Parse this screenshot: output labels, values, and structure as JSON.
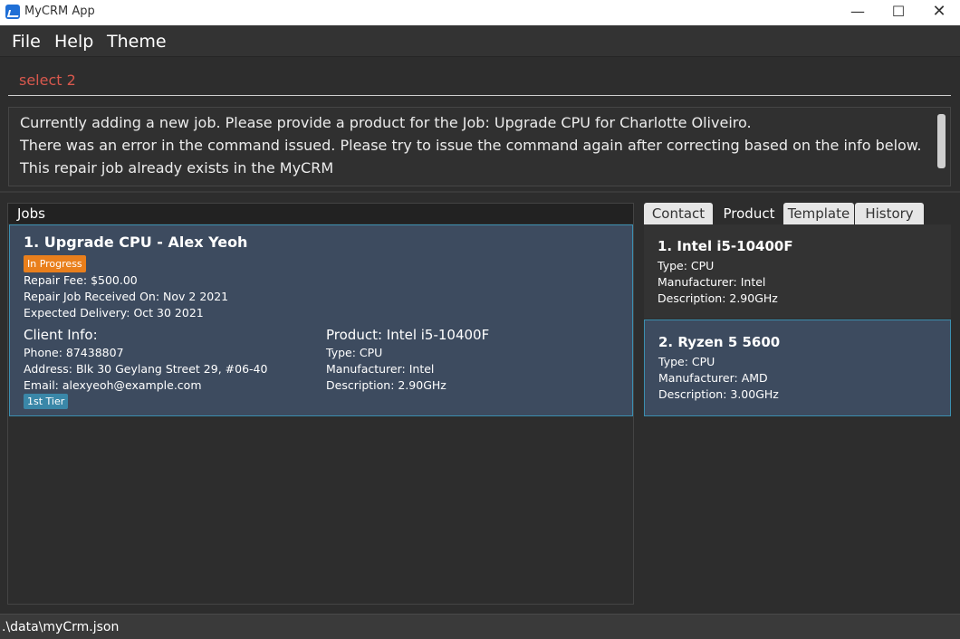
{
  "window": {
    "title": "MyCRM App",
    "minimize": "—",
    "maximize": "☐",
    "close": "✕"
  },
  "menu": {
    "file": "File",
    "help": "Help",
    "theme": "Theme"
  },
  "command": {
    "value": "select 2"
  },
  "result": {
    "line1": "Currently adding a new job. Please provide a product for the Job: Upgrade CPU for Charlotte Oliveiro.",
    "line2": "There was an error in the command issued. Please try to issue the command again after correcting based on the info below.",
    "line3": "This repair job already exists in the MyCRM"
  },
  "jobs": {
    "header": "Jobs",
    "items": [
      {
        "title": "1. Upgrade CPU - Alex Yeoh",
        "status": "In Progress",
        "fee": "Repair Fee: $500.00",
        "received": "Repair Job Received On: Nov 2 2021",
        "delivery": "Expected Delivery: Oct 30 2021",
        "client_title": "Client Info:",
        "phone": "Phone: 87438807",
        "address": "Address: Blk 30 Geylang Street 29, #06-40",
        "email": "Email: alexyeoh@example.com",
        "tier": "1st Tier",
        "product_title": "Product: Intel i5-10400F",
        "product_type": "Type: CPU",
        "product_manufacturer": "Manufacturer: Intel",
        "product_description": "Description: 2.90GHz"
      }
    ]
  },
  "tabs": {
    "contact": "Contact",
    "product": "Product",
    "template": "Template",
    "history": "History",
    "selected": "Product"
  },
  "products": [
    {
      "name": "1.  Intel i5-10400F",
      "type": "Type: CPU",
      "manufacturer": "Manufacturer: Intel",
      "description": "Description: 2.90GHz"
    },
    {
      "name": "2.  Ryzen 5 5600",
      "type": "Type: CPU",
      "manufacturer": "Manufacturer: AMD",
      "description": "Description: 3.00GHz"
    }
  ],
  "statusbar": {
    "path": ".\\data\\myCrm.json"
  },
  "colors": {
    "background": "#2d2d2d",
    "selected_card": "#3d4b5f",
    "status_in_progress": "#e97f1c",
    "tier_badge": "#3a87a8",
    "command_text": "#d8584d"
  }
}
